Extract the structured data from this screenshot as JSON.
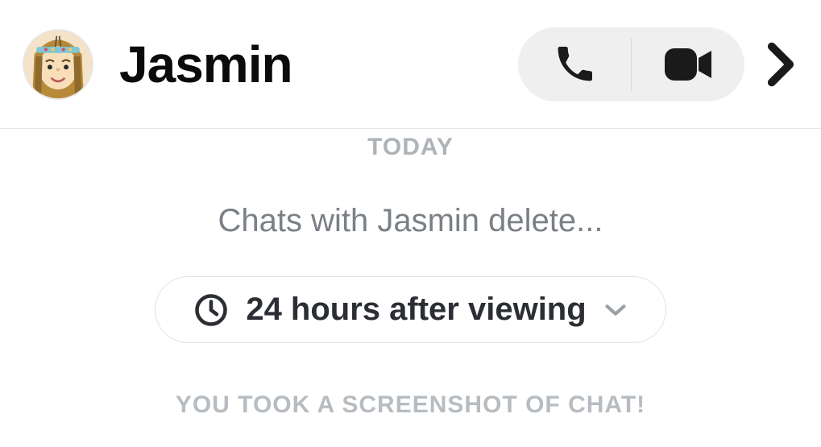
{
  "header": {
    "contact_name": "Jasmin"
  },
  "chat": {
    "day_label": "TODAY",
    "sub_text": "Chats with Jasmin delete...",
    "retention_label": "24 hours after viewing",
    "notice": "YOU TOOK A SCREENSHOT OF CHAT!"
  }
}
